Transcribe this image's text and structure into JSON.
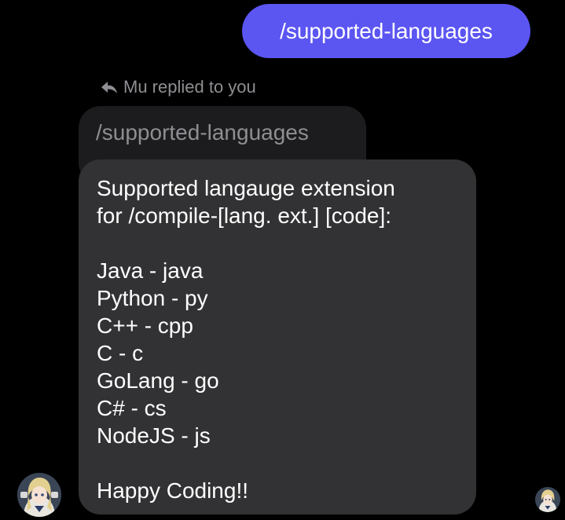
{
  "sent_message": {
    "text": "/supported-languages"
  },
  "reply_header": {
    "icon": "reply-arrow-icon",
    "text": "Mu replied to you"
  },
  "quoted_message": {
    "text": "/supported-languages"
  },
  "received_message": {
    "lines": [
      "Supported langauge extension",
      "for /compile-[lang. ext.] [code]:",
      "",
      "Java - java",
      "Python - py",
      "C++ - cpp",
      "C - c",
      "GoLang - go",
      "C# - cs",
      "NodeJS - js",
      "",
      "Happy Coding!!"
    ]
  },
  "colors": {
    "background": "#000000",
    "sent_bubble": "#5b55f2",
    "received_bubble": "#323234",
    "quoted_bubble": "#1c1c1e",
    "secondary_text": "#8e8e93"
  }
}
